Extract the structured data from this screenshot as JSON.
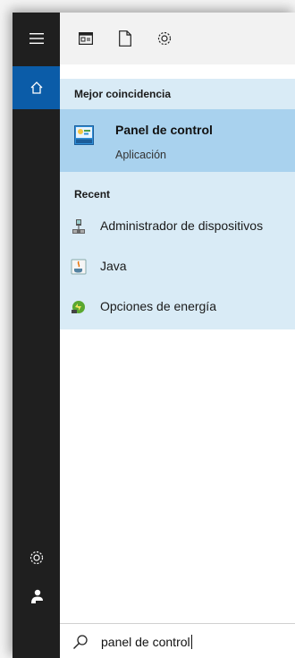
{
  "toolbar": {
    "icons": [
      "apps-icon",
      "document-icon",
      "settings-icon"
    ]
  },
  "results": {
    "best_match_header": "Mejor coincidencia",
    "best_match": {
      "title": "Panel de control",
      "subtitle": "Aplicación",
      "icon": "control-panel-icon"
    },
    "recent_header": "Recent",
    "recent": [
      {
        "label": "Administrador de dispositivos",
        "icon": "device-manager-icon"
      },
      {
        "label": "Java",
        "icon": "java-icon"
      },
      {
        "label": "Opciones de energía",
        "icon": "power-options-icon"
      }
    ]
  },
  "search": {
    "value": "panel de control"
  },
  "colors": {
    "rail": "#1f1f1f",
    "accent": "#0b5ca8",
    "panel": "#d9ebf6",
    "selected": "#a9d2ee"
  }
}
